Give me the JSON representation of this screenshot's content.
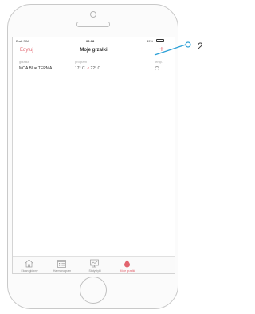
{
  "status": {
    "carrier": "Brak SIM",
    "time": "09:18",
    "battery": "49%"
  },
  "navbar": {
    "edit_label": "Edytuj",
    "title": "Moje grzałki",
    "add_label": "+"
  },
  "table": {
    "headers": {
      "name": "grzałka",
      "program": "program",
      "temp": "temp."
    },
    "rows": [
      {
        "name": "MOA Blue TERMA",
        "program_from": "17° C",
        "arrow": "↗",
        "program_to": "22° C"
      }
    ]
  },
  "tabs": [
    {
      "label": "Ekran główny",
      "icon": "home-icon"
    },
    {
      "label": "Harmonogram",
      "icon": "calendar-icon"
    },
    {
      "label": "Statystyki",
      "icon": "statistics-icon"
    },
    {
      "label": "Moje grzałki",
      "icon": "heater-icon",
      "active": true
    }
  ],
  "callout": {
    "number": "2"
  },
  "colors": {
    "accent": "#e2646e"
  }
}
